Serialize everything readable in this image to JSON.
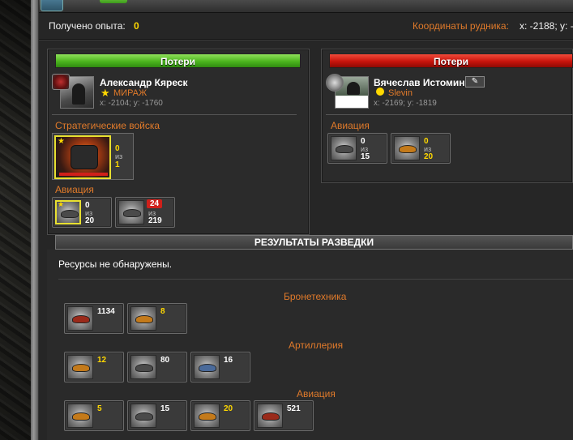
{
  "header": {
    "exp_label": "Получено опыта:",
    "exp_value": "0",
    "mine_coords_label": "Координаты рудника:",
    "mine_coords_value": "x: -2188; y: -"
  },
  "attacker": {
    "losses_label": "Потери",
    "name": "Александр Кяреск",
    "clan": "МИРАЖ",
    "coords": "x: -2104; y: -1760",
    "sections": [
      {
        "title": "Стратегические войска",
        "units": [
          {
            "icon": "strategic-mech-icon",
            "count": "0",
            "of_label": "из",
            "total": "1"
          }
        ]
      },
      {
        "title": "Авиация",
        "units": [
          {
            "icon": "aircraft-icon",
            "count": "0",
            "of_label": "из",
            "total": "20"
          },
          {
            "icon": "aircraft-icon",
            "count": "24",
            "of_label": "из",
            "total": "219"
          }
        ]
      }
    ]
  },
  "defender": {
    "losses_label": "Потери",
    "name": "Вячеслав Истомин",
    "clan": "Slevin",
    "coords": "x: -2169; y: -1819",
    "sections": [
      {
        "title": "Авиация",
        "units": [
          {
            "icon": "aircraft-icon",
            "count": "0",
            "of_label": "из",
            "total": "15"
          },
          {
            "icon": "aircraft-icon",
            "count": "0",
            "of_label": "из",
            "total": "20"
          }
        ]
      }
    ]
  },
  "intel": {
    "title": "РЕЗУЛЬТАТЫ РАЗВЕДКИ",
    "no_resources": "Ресурсы не обнаружены.",
    "categories": [
      {
        "title": "Бронетехника",
        "units": [
          "1134",
          "8"
        ]
      },
      {
        "title": "Артиллерия",
        "units": [
          "12",
          "80",
          "16"
        ]
      },
      {
        "title": "Авиация",
        "units": [
          "5",
          "15",
          "20",
          "521"
        ]
      }
    ]
  },
  "colors": {
    "accent_orange": "#e07a2a",
    "highlight_yellow": "#ffd800",
    "losses_green": "#4cb51e",
    "losses_red": "#c8140c"
  }
}
